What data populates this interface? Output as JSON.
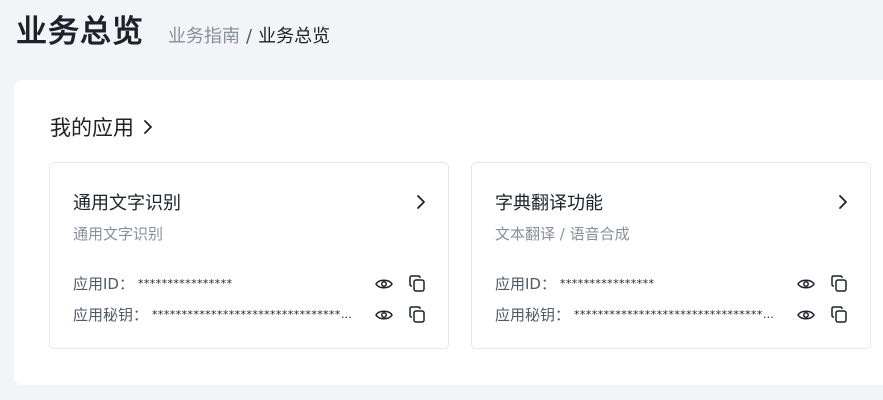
{
  "header": {
    "title": "业务总览",
    "breadcrumb": {
      "parent": "业务指南",
      "separator": "/",
      "current": "业务总览"
    }
  },
  "apps_section": {
    "title": "我的应用",
    "cards": [
      {
        "title": "通用文字识别",
        "subtitle": "通用文字识别",
        "app_id_label": "应用ID：",
        "app_id_masked": "****************",
        "secret_label": "应用秘钥：",
        "secret_masked": "**************************************"
      },
      {
        "title": "字典翻译功能",
        "subtitle": "文本翻译 / 语音合成",
        "app_id_label": "应用ID：",
        "app_id_masked": "****************",
        "secret_label": "应用秘钥：",
        "secret_masked": "**************************************"
      }
    ]
  },
  "icons": {
    "chevron": "chevron-right-icon",
    "reveal": "eye-icon",
    "copy": "copy-icon"
  },
  "colors": {
    "background": "#f2f4f7",
    "text_primary": "#1d2129",
    "text_secondary": "#86909c",
    "border": "#e5e6eb"
  }
}
